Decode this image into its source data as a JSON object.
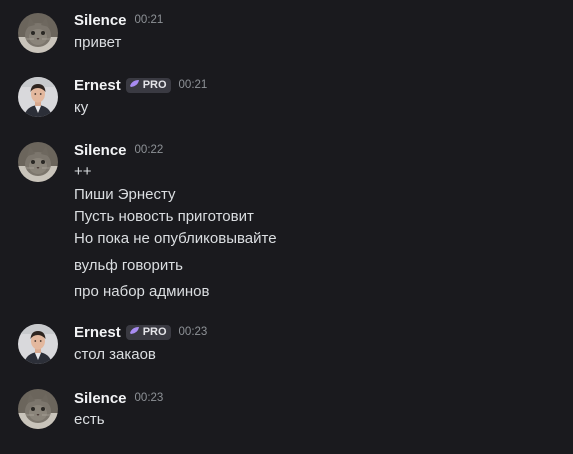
{
  "colors": {
    "background": "#1a1a1e",
    "author": "#f2f3f5",
    "text": "#dbdee1",
    "timestamp": "#8e9297",
    "pro_badge_bg": "#3a3a42",
    "pro_gem": "#a98cf3"
  },
  "messages": [
    {
      "author": "Silence",
      "avatar_icon": "cat-avatar-icon",
      "time": "00:21",
      "pro": false,
      "lines": [
        "привет"
      ]
    },
    {
      "author": "Ernest",
      "avatar_icon": "man-avatar-icon",
      "time": "00:21",
      "pro": true,
      "pro_label": "PRO",
      "lines": [
        "ку"
      ]
    },
    {
      "author": "Silence",
      "avatar_icon": "cat-avatar-icon",
      "time": "00:22",
      "pro": false,
      "lines": [
        "++",
        "Пиши Эрнесту",
        "Пусть новость приготовит",
        "Но пока не опубликовывайте",
        "вульф говорить",
        "про набор админов"
      ]
    },
    {
      "author": "Ernest",
      "avatar_icon": "man-avatar-icon",
      "time": "00:23",
      "pro": true,
      "pro_label": "PRO",
      "lines": [
        "стол закаов"
      ]
    },
    {
      "author": "Silence",
      "avatar_icon": "cat-avatar-icon",
      "time": "00:23",
      "pro": false,
      "lines": [
        "есть"
      ]
    }
  ]
}
